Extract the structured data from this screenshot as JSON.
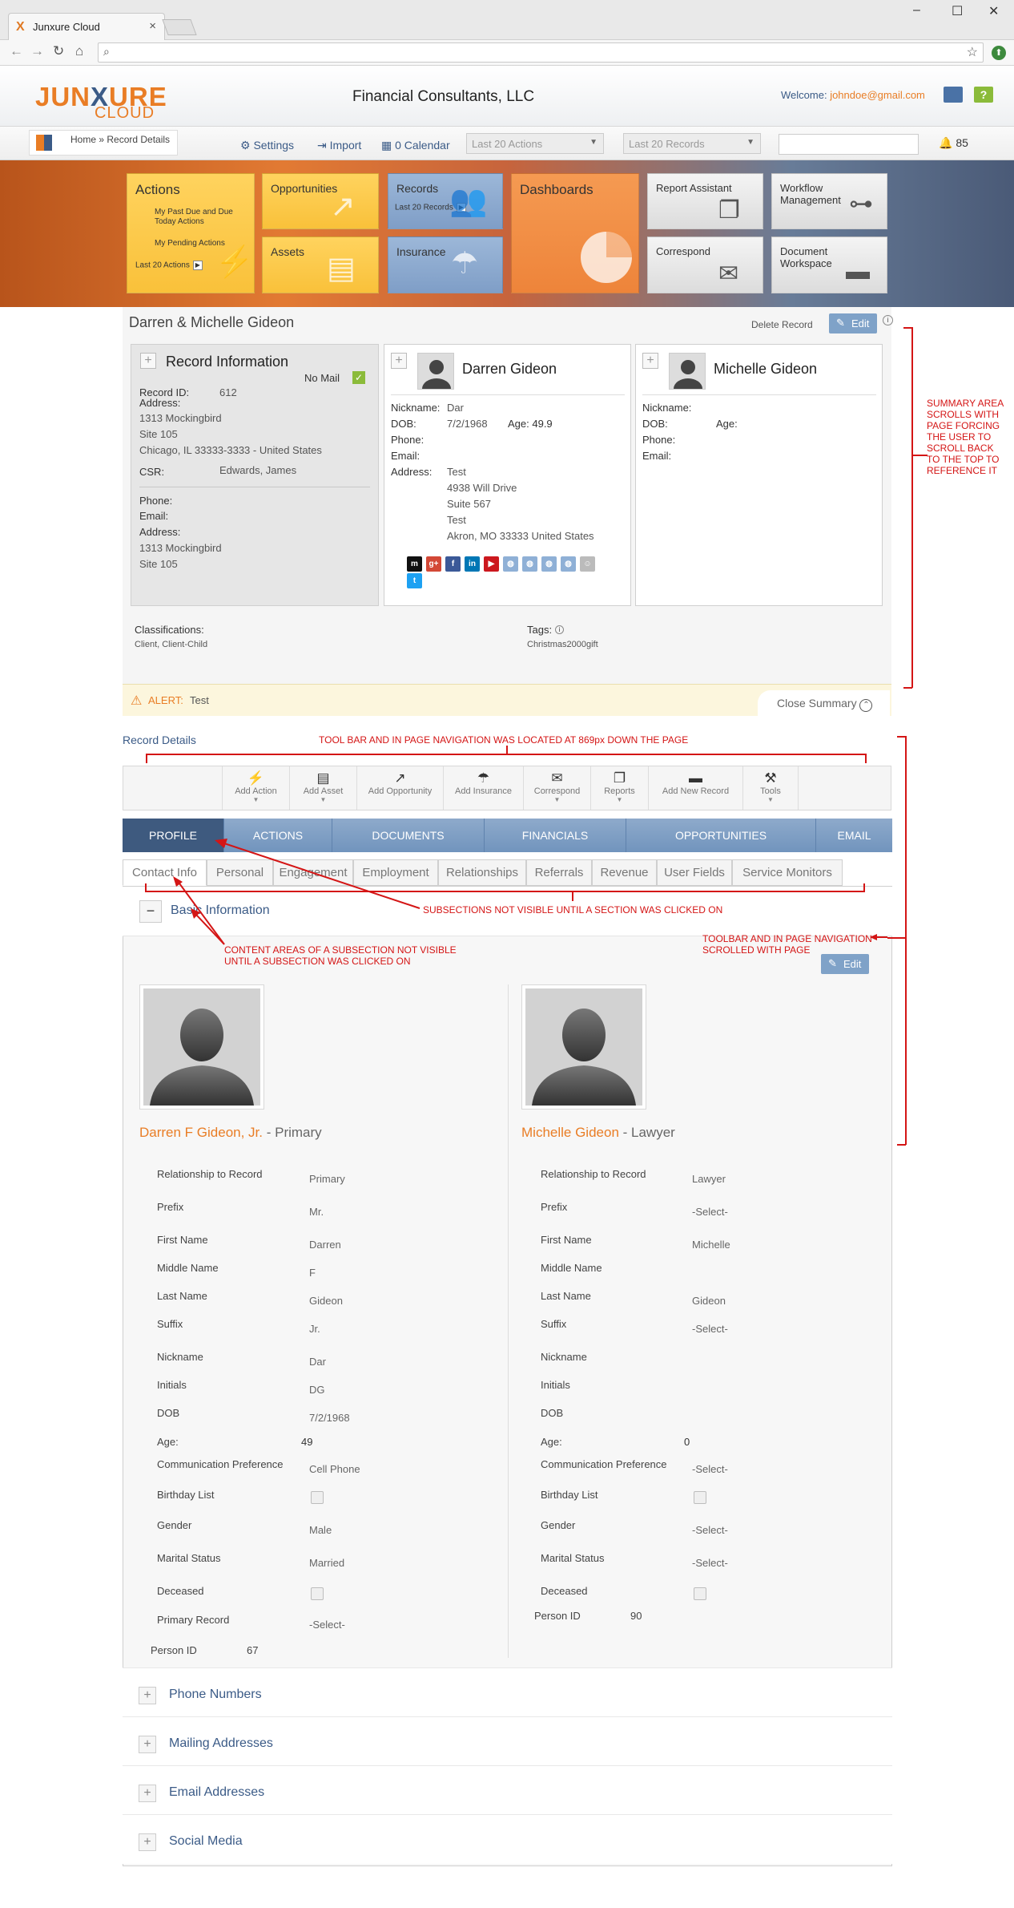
{
  "browser": {
    "tab_title": "Junxure Cloud",
    "tab_close": "×",
    "min": "–",
    "max": "☐",
    "close": "✕"
  },
  "header": {
    "logo_top": "JUNXURE",
    "logo_top_a": "JUN",
    "logo_top_x": "X",
    "logo_top_b": "URE",
    "logo_bottom": "CLOUD",
    "company": "Financial Consultants, LLC",
    "welcome_label": "Welcome:",
    "welcome_email": "johndoe@gmail.com"
  },
  "toolbar": {
    "breadcrumb": "Home » Record Details",
    "settings": "Settings",
    "import": "Import",
    "calendar": "0 Calendar",
    "last_actions": "Last 20 Actions",
    "last_records": "Last 20 Records",
    "notifications": "85"
  },
  "dashboard": {
    "actions": {
      "title": "Actions",
      "l1": "My Past Due and Due",
      "l2": "Today Actions",
      "l3": "My Pending Actions",
      "l4": "Last 20 Actions"
    },
    "opportunities": "Opportunities",
    "assets": "Assets",
    "records": {
      "title": "Records",
      "sub": "Last 20 Records"
    },
    "insurance": "Insurance",
    "dashboards": "Dashboards",
    "report_assistant": "Report Assistant",
    "workflow": "Workflow Management",
    "correspond": "Correspond",
    "document_workspace": "Document Workspace"
  },
  "summary": {
    "title": "Darren & Michelle Gideon",
    "delete": "Delete Record",
    "edit": "Edit",
    "info_icon": "i",
    "record_info": {
      "title": "Record Information",
      "no_mail": "No Mail",
      "record_id_label": "Record ID:",
      "record_id": "612",
      "address_label": "Address:",
      "addr1": "1313 Mockingbird",
      "addr2": "Site 105",
      "addr3": "Chicago, IL 33333-3333 - United States",
      "csr_label": "CSR:",
      "csr": "Edwards, James",
      "phone_label": "Phone:",
      "email_label": "Email:",
      "address2_label": "Address:",
      "addr4": "1313 Mockingbird",
      "addr5": "Site 105"
    },
    "person1": {
      "name": "Darren Gideon",
      "nickname_label": "Nickname:",
      "nickname": "Dar",
      "dob_label": "DOB:",
      "dob": "7/2/1968",
      "age": "Age: 49.9",
      "phone_label": "Phone:",
      "email_label": "Email:",
      "address_label": "Address:",
      "a1": "Test",
      "a2": "4938 Will Drive",
      "a3": "Suite 567",
      "a4": "Test",
      "a5": "Akron, MO 33333 United States"
    },
    "person2": {
      "name": "Michelle Gideon",
      "nickname_label": "Nickname:",
      "dob_label": "DOB:",
      "age_label": "Age:",
      "phone_label": "Phone:",
      "email_label": "Email:"
    },
    "classifications_label": "Classifications:",
    "classifications": "Client, Client-Child",
    "tags_label": "Tags:",
    "tags": "Christmas2000gift",
    "alert_label": "ALERT:",
    "alert": "Test",
    "close_summary": "Close Summary"
  },
  "details": {
    "title": "Record Details",
    "actions": [
      "Add Action",
      "Add Asset",
      "Add Opportunity",
      "Add Insurance",
      "Correspond",
      "Reports",
      "Add New Record",
      "Tools"
    ],
    "main_tabs": [
      "PROFILE",
      "ACTIONS",
      "DOCUMENTS",
      "FINANCIALS",
      "OPPORTUNITIES",
      "EMAIL"
    ],
    "sub_tabs": [
      "Contact Info",
      "Personal",
      "Engagement",
      "Employment",
      "Relationships",
      "Referrals",
      "Revenue",
      "User Fields",
      "Service Monitors"
    ],
    "basic_info": "Basic Information",
    "edit": "Edit",
    "p1": {
      "name": "Darren F Gideon, Jr.",
      "role": " - Primary",
      "fields": [
        [
          "Relationship to Record",
          "Primary"
        ],
        [
          "Prefix",
          "Mr."
        ],
        [
          "First Name",
          "Darren"
        ],
        [
          "Middle Name",
          "F"
        ],
        [
          "Last Name",
          "Gideon"
        ],
        [
          "Suffix",
          "Jr."
        ],
        [
          "Nickname",
          "Dar"
        ],
        [
          "Initials",
          "DG"
        ],
        [
          "DOB",
          "7/2/1968"
        ],
        [
          "Age:",
          "49"
        ],
        [
          "Communication Preference",
          "Cell Phone"
        ],
        [
          "Birthday List",
          ""
        ],
        [
          "Gender",
          "Male"
        ],
        [
          "Marital Status",
          "Married"
        ],
        [
          "Deceased",
          ""
        ],
        [
          "Primary Record",
          "-Select-"
        ]
      ],
      "person_id_label": "Person ID",
      "person_id": "67"
    },
    "p2": {
      "name": "Michelle Gideon",
      "role": " - Lawyer",
      "fields": [
        [
          "Relationship to Record",
          "Lawyer"
        ],
        [
          "Prefix",
          "-Select-"
        ],
        [
          "First Name",
          "Michelle"
        ],
        [
          "Middle Name",
          ""
        ],
        [
          "Last Name",
          "Gideon"
        ],
        [
          "Suffix",
          "-Select-"
        ],
        [
          "Nickname",
          ""
        ],
        [
          "Initials",
          ""
        ],
        [
          "DOB",
          ""
        ],
        [
          "Age:",
          "0"
        ],
        [
          "Communication Preference",
          "-Select-"
        ],
        [
          "Birthday List",
          ""
        ],
        [
          "Gender",
          "-Select-"
        ],
        [
          "Marital Status",
          "-Select-"
        ],
        [
          "Deceased",
          ""
        ]
      ],
      "person_id_label": "Person ID",
      "person_id": "90"
    },
    "collapsed": [
      "Phone Numbers",
      "Mailing Addresses",
      "Email Addresses",
      "Social Media"
    ]
  },
  "annotations": {
    "summary_scroll": "SUMMARY AREA SCROLLS WITH PAGE FORCING THE USER TO SCROLL BACK TO THE TOP TO REFERENCE IT",
    "toolbar_position": "TOOL BAR  AND IN PAGE NAVIGATION WAS LOCATED AT 869px DOWN THE PAGE",
    "subsections": "SUBSECTIONS NOT VISIBLE UNTIL A SECTION WAS CLICKED ON",
    "content_areas": "CONTENT AREAS OF A SUBSECTION NOT VISIBLE UNTIL A SUBSECTION WAS CLICKED ON",
    "toolbar_scroll": "TOOLBAR AND IN PAGE NAVIGATION SCROLLED WITH PAGE"
  },
  "colors": {
    "accent_orange": "#e97d25",
    "brand_blue": "#3b5b87",
    "annotation_red": "#d41515",
    "tab_active": "#3e5a7f"
  }
}
